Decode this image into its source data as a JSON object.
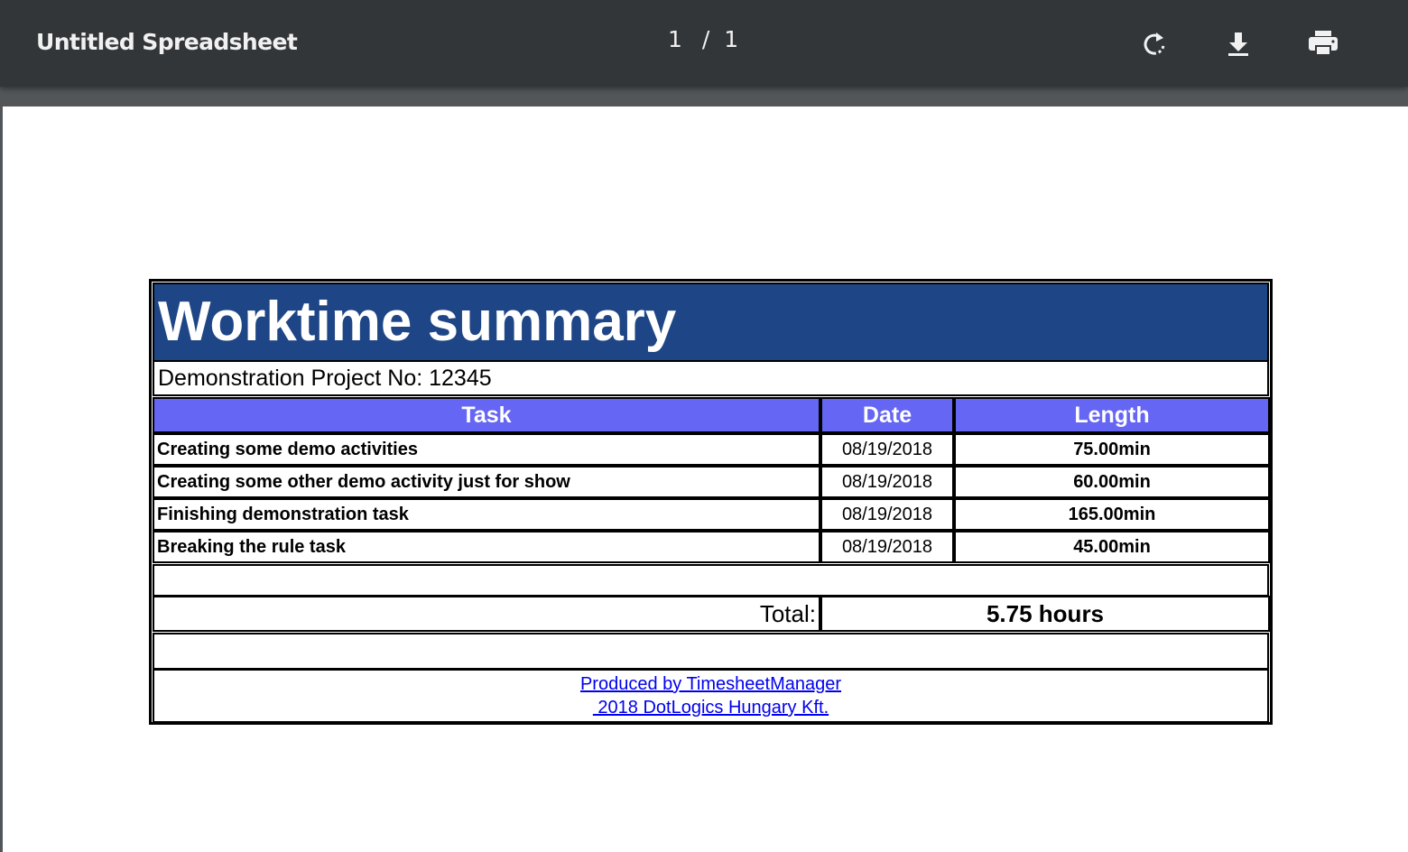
{
  "toolbar": {
    "title": "Untitled Spreadsheet",
    "page_current": "1",
    "page_separator": "/",
    "page_total": "1",
    "icons": [
      "rotate-icon",
      "download-icon",
      "print-icon"
    ]
  },
  "sheet": {
    "title": "Worktime summary",
    "project": "Demonstration Project No: 12345",
    "headers": {
      "task": "Task",
      "date": "Date",
      "length": "Length"
    },
    "rows": [
      {
        "task": "Creating some demo activities",
        "date": "08/19/2018",
        "length": "75.00min"
      },
      {
        "task": "Creating some other demo activity just for show",
        "date": "08/19/2018",
        "length": "60.00min"
      },
      {
        "task": "Finishing demonstration task",
        "date": "08/19/2018",
        "length": "165.00min"
      },
      {
        "task": "Breaking the rule task",
        "date": "08/19/2018",
        "length": "45.00min"
      }
    ],
    "total_label": "Total:",
    "total_value": "5.75 hours",
    "footer_line1": "Produced by TimesheetManager",
    "footer_line2": " 2018 DotLogics Hungary Kft."
  },
  "colors": {
    "toolbar_bg": "#323639",
    "viewer_bg": "#525659",
    "title_bg": "#1e4585",
    "header_bg": "#6666f4",
    "link": "#0000ee"
  }
}
